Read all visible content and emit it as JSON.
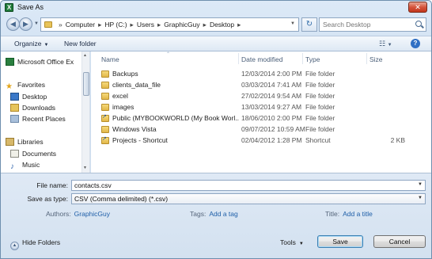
{
  "window": {
    "title": "Save As",
    "app_icon_letter": "X",
    "close_glyph": "✕"
  },
  "address": {
    "crumbs": [
      "Computer",
      "HP (C:)",
      "Users",
      "GraphicGuy",
      "Desktop"
    ],
    "search_placeholder": "Search Desktop"
  },
  "toolbar": {
    "organize_label": "Organize",
    "new_folder_label": "New folder",
    "help_label": "?"
  },
  "nav": {
    "items": [
      {
        "label": "Microsoft Office Ex",
        "icon": "excel-icon"
      },
      {
        "label": "Favorites",
        "icon": "star-icon"
      },
      {
        "label": "Desktop",
        "icon": "desktop-icon"
      },
      {
        "label": "Downloads",
        "icon": "downloads-icon"
      },
      {
        "label": "Recent Places",
        "icon": "recent-places-icon"
      },
      {
        "label": "Libraries",
        "icon": "libraries-icon"
      },
      {
        "label": "Documents",
        "icon": "documents-icon"
      },
      {
        "label": "Music",
        "icon": "music-icon"
      }
    ]
  },
  "files": {
    "columns": {
      "name": "Name",
      "date": "Date modified",
      "type": "Type",
      "size": "Size"
    },
    "rows": [
      {
        "name": "Backups",
        "date": "12/03/2014 2:00 PM",
        "type": "File folder",
        "size": ""
      },
      {
        "name": "clients_data_file",
        "date": "03/03/2014 7:41 AM",
        "type": "File folder",
        "size": ""
      },
      {
        "name": "excel",
        "date": "27/02/2014 9:54 AM",
        "type": "File folder",
        "size": ""
      },
      {
        "name": "images",
        "date": "13/03/2014 9:27 AM",
        "type": "File folder",
        "size": ""
      },
      {
        "name": "Public (MYBOOKWORLD (My Book Worl...",
        "date": "18/06/2010 2:00 PM",
        "type": "File folder",
        "size": ""
      },
      {
        "name": "Windows Vista",
        "date": "09/07/2012 10:59 AM",
        "type": "File folder",
        "size": ""
      },
      {
        "name": "Projects - Shortcut",
        "date": "02/04/2012 1:28 PM",
        "type": "Shortcut",
        "size": "2 KB"
      }
    ]
  },
  "form": {
    "filename_label": "File name:",
    "filename_value": "contacts.csv",
    "savetype_label": "Save as type:",
    "savetype_value": "CSV (Comma delimited) (*.csv)",
    "authors_label": "Authors:",
    "authors_value": "GraphicGuy",
    "tags_label": "Tags:",
    "tags_value": "Add a tag",
    "title_label": "Title:",
    "title_value": "Add a title"
  },
  "footer": {
    "hide_folders_label": "Hide Folders",
    "tools_label": "Tools",
    "save_label": "Save",
    "cancel_label": "Cancel"
  }
}
